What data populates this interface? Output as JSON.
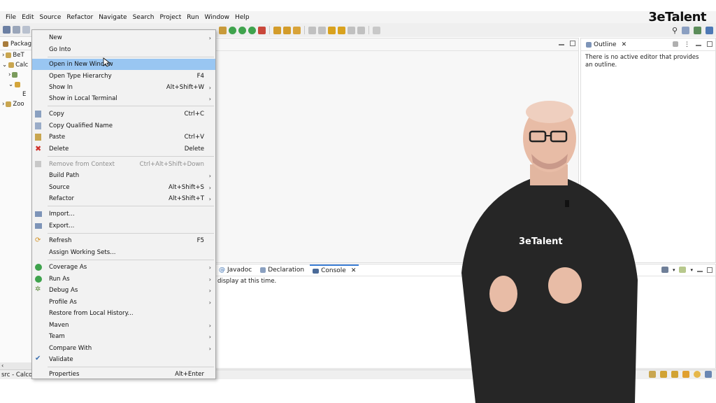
{
  "brand": {
    "logo": "3eTalent",
    "shirt_logo": "3eTalent"
  },
  "menubar": [
    "File",
    "Edit",
    "Source",
    "Refactor",
    "Navigate",
    "Search",
    "Project",
    "Run",
    "Window",
    "Help"
  ],
  "package_explorer": {
    "title": "Packag",
    "rows": [
      "BeT",
      "Calc",
      "",
      "",
      "E",
      "Zoo"
    ]
  },
  "context_menu": {
    "items": [
      {
        "label": "New",
        "shortcut": "",
        "arrow": true
      },
      {
        "label": "Go Into",
        "shortcut": "",
        "arrow": false
      },
      {
        "label": "Open in New Window",
        "shortcut": "",
        "arrow": false,
        "highlighted": true
      },
      {
        "label": "Open Type Hierarchy",
        "shortcut": "F4",
        "arrow": false
      },
      {
        "label": "Show In",
        "shortcut": "Alt+Shift+W",
        "arrow": true
      },
      {
        "label": "Show in Local Terminal",
        "shortcut": "",
        "arrow": true
      },
      {
        "label": "Copy",
        "shortcut": "Ctrl+C",
        "arrow": false
      },
      {
        "label": "Copy Qualified Name",
        "shortcut": "",
        "arrow": false
      },
      {
        "label": "Paste",
        "shortcut": "Ctrl+V",
        "arrow": false
      },
      {
        "label": "Delete",
        "shortcut": "Delete",
        "arrow": false
      },
      {
        "label": "Remove from Context",
        "shortcut": "Ctrl+Alt+Shift+Down",
        "arrow": false,
        "disabled": true
      },
      {
        "label": "Build Path",
        "shortcut": "",
        "arrow": true
      },
      {
        "label": "Source",
        "shortcut": "Alt+Shift+S",
        "arrow": true
      },
      {
        "label": "Refactor",
        "shortcut": "Alt+Shift+T",
        "arrow": true
      },
      {
        "label": "Import...",
        "shortcut": "",
        "arrow": false
      },
      {
        "label": "Export...",
        "shortcut": "",
        "arrow": false
      },
      {
        "label": "Refresh",
        "shortcut": "F5",
        "arrow": false
      },
      {
        "label": "Assign Working Sets...",
        "shortcut": "",
        "arrow": false
      },
      {
        "label": "Coverage As",
        "shortcut": "",
        "arrow": true
      },
      {
        "label": "Run As",
        "shortcut": "",
        "arrow": true
      },
      {
        "label": "Debug As",
        "shortcut": "",
        "arrow": true
      },
      {
        "label": "Profile As",
        "shortcut": "",
        "arrow": true
      },
      {
        "label": "Restore from Local History...",
        "shortcut": "",
        "arrow": false
      },
      {
        "label": "Maven",
        "shortcut": "",
        "arrow": true
      },
      {
        "label": "Team",
        "shortcut": "",
        "arrow": true
      },
      {
        "label": "Compare With",
        "shortcut": "",
        "arrow": true
      },
      {
        "label": "Validate",
        "shortcut": "",
        "arrow": false
      },
      {
        "label": "Properties",
        "shortcut": "Alt+Enter",
        "arrow": false
      }
    ]
  },
  "outline": {
    "title": "Outline",
    "message": "There is no active editor that provides an outline."
  },
  "bottom_panel": {
    "tabs": [
      "Javadoc",
      "Declaration",
      "Console"
    ],
    "message": "display at this time."
  },
  "status": {
    "text": "src - Calco"
  },
  "colors": {
    "highlight": "#99c6f2",
    "menu_bg": "#f2f2f2",
    "accent_blue": "#3d7fd6"
  }
}
